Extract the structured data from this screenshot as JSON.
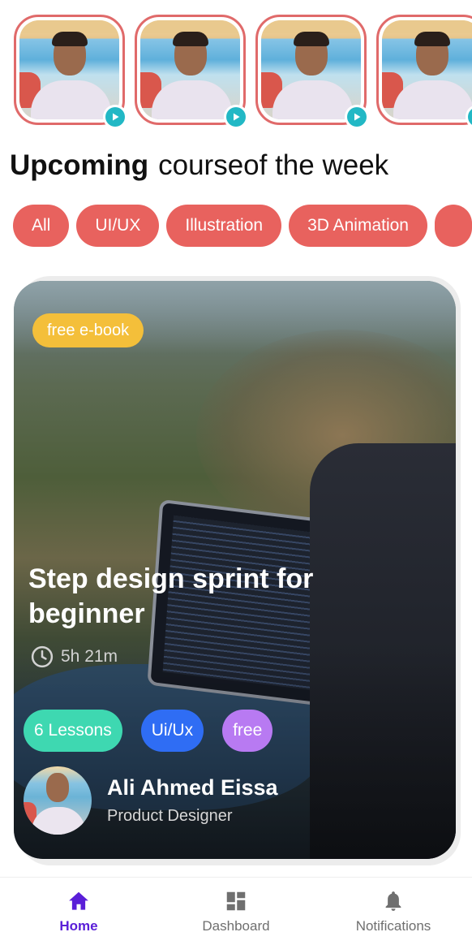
{
  "stories": [
    {
      "name": "story-1"
    },
    {
      "name": "story-2"
    },
    {
      "name": "story-3"
    },
    {
      "name": "story-4"
    }
  ],
  "heading": {
    "bold": "Upcoming",
    "light": "courseof the week"
  },
  "categories": [
    "All",
    "UI/UX",
    "Illustration",
    "3D Animation",
    ""
  ],
  "course": {
    "badge": "free e-book",
    "title": "Step design sprint for beginner",
    "duration": "5h 21m",
    "tags": [
      "6 Lessons",
      "Ui/Ux",
      "free"
    ],
    "author_name": "Ali Ahmed Eissa",
    "author_role": "Product Designer"
  },
  "nav": {
    "home": "Home",
    "dashboard": "Dashboard",
    "notifications": "Notifications"
  },
  "colors": {
    "accent": "#e8625e",
    "badge": "#f4bf3a",
    "tag_green": "#3ed8b1",
    "tag_blue": "#2f6df4",
    "tag_purple": "#b87af2",
    "nav_active": "#5a1ed8",
    "play": "#22b8c5"
  },
  "icons": {
    "play": "play-icon",
    "clock": "clock-icon",
    "home": "home-icon",
    "dashboard": "dashboard-icon",
    "notifications": "bell-icon"
  }
}
